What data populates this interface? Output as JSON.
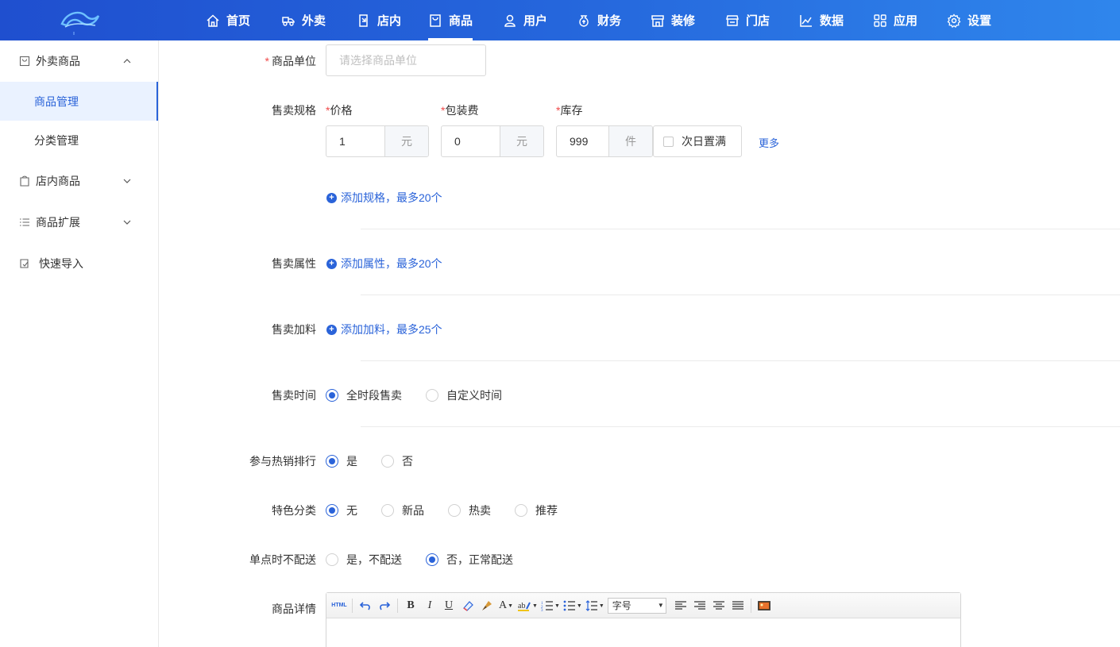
{
  "nav": {
    "items": [
      {
        "label": "首页",
        "icon": "home-icon"
      },
      {
        "label": "外卖",
        "icon": "delivery-icon"
      },
      {
        "label": "店内",
        "icon": "dine-in-icon"
      },
      {
        "label": "商品",
        "icon": "goods-icon"
      },
      {
        "label": "用户",
        "icon": "user-icon"
      },
      {
        "label": "财务",
        "icon": "finance-icon"
      },
      {
        "label": "装修",
        "icon": "decorate-icon"
      },
      {
        "label": "门店",
        "icon": "store-icon"
      },
      {
        "label": "数据",
        "icon": "chart-icon"
      },
      {
        "label": "应用",
        "icon": "apps-icon"
      },
      {
        "label": "设置",
        "icon": "gear-icon"
      }
    ],
    "active": "商品"
  },
  "sidebar": {
    "group_delivery": "外卖商品",
    "sub_goods_manage": "商品管理",
    "sub_category_manage": "分类管理",
    "group_instore": "店内商品",
    "group_extend": "商品扩展",
    "group_import": "快速导入"
  },
  "form": {
    "unit_label": "商品单位",
    "unit_placeholder": "请选择商品单位",
    "spec_label": "售卖规格",
    "price_label": "价格",
    "price_value": "1",
    "price_unit": "元",
    "package_label": "包装费",
    "package_value": "0",
    "package_unit": "元",
    "stock_label": "库存",
    "stock_value": "999",
    "stock_unit": "件",
    "next_day_full": "次日置满",
    "more_link": "更多",
    "add_spec": "添加规格，最多20个",
    "attr_label": "售卖属性",
    "add_attr": "添加属性，最多20个",
    "addon_label": "售卖加料",
    "add_addon": "添加加料，最多25个",
    "time_label": "售卖时间",
    "time_all": "全时段售卖",
    "time_custom": "自定义时间",
    "hot_label": "参与热销排行",
    "hot_yes": "是",
    "hot_no": "否",
    "feature_label": "特色分类",
    "feature_none": "无",
    "feature_new": "新品",
    "feature_hot": "热卖",
    "feature_recommend": "推荐",
    "single_label": "单点时不配送",
    "single_yes": "是，不配送",
    "single_no": "否，正常配送",
    "detail_label": "商品详情"
  },
  "editor": {
    "html_btn": "HTML",
    "bold": "B",
    "italic": "I",
    "underline": "U",
    "font_color": "A",
    "font_size_select": "字号"
  },
  "colors": {
    "primary": "#2a63d9",
    "required": "#f04a4a",
    "topbar_start": "#1f4fcf",
    "topbar_end": "#2f86ec"
  }
}
